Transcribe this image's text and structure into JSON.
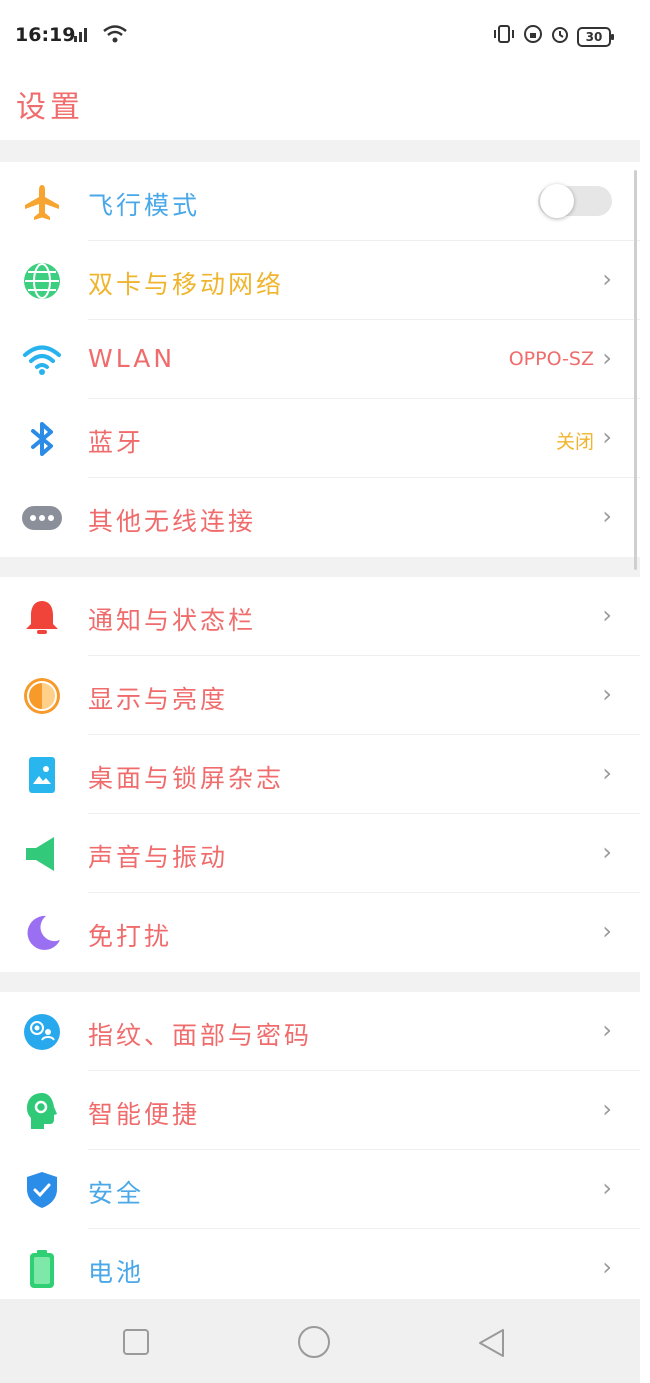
{
  "status_bar": {
    "time": "16:19",
    "battery": "30"
  },
  "header": {
    "title": "设置"
  },
  "groups": [
    {
      "items": [
        {
          "label": "飞行模式",
          "icon": "airplane-icon",
          "color": "#f7a530",
          "label_color": "#4aa8e8",
          "toggle": false
        },
        {
          "label": "双卡与移动网络",
          "icon": "globe-icon",
          "color": "#3ccf7f",
          "label_color": "#f0b52e"
        },
        {
          "label": "WLAN",
          "value": "OPPO-SZ",
          "icon": "wifi-icon",
          "color": "#29b3ee",
          "label_color": "#f06c6c",
          "value_color": "#f06c6c"
        },
        {
          "label": "蓝牙",
          "value": "关闭",
          "icon": "bluetooth-icon",
          "color": "#2b8ce8",
          "label_color": "#f06c6c",
          "value_color": "#f0b52e"
        },
        {
          "label": "其他无线连接",
          "icon": "more-icon",
          "color": "#8a8f99",
          "label_color": "#f06c6c"
        }
      ]
    },
    {
      "items": [
        {
          "label": "通知与状态栏",
          "icon": "bell-icon",
          "color": "#f0443a",
          "label_color": "#f06c6c"
        },
        {
          "label": "显示与亮度",
          "icon": "brightness-icon",
          "color": "#f79a2a",
          "label_color": "#f06c6c"
        },
        {
          "label": "桌面与锁屏杂志",
          "icon": "wallpaper-icon",
          "color": "#29b6ef",
          "label_color": "#f06c6c"
        },
        {
          "label": "声音与振动",
          "icon": "speaker-icon",
          "color": "#33c97a",
          "label_color": "#f06c6c"
        },
        {
          "label": "免打扰",
          "icon": "moon-icon",
          "color": "#9b6ff2",
          "label_color": "#f06c6c"
        }
      ]
    },
    {
      "items": [
        {
          "label": "指纹、面部与密码",
          "icon": "fingerprint-face-icon",
          "color": "#28a9ee",
          "label_color": "#f06c6c"
        },
        {
          "label": "智能便捷",
          "icon": "smart-assist-icon",
          "color": "#2fc978",
          "label_color": "#f06c6c"
        },
        {
          "label": "安全",
          "icon": "shield-icon",
          "color": "#2b8de8",
          "label_color": "#4aa8e8"
        },
        {
          "label": "电池",
          "icon": "battery-icon",
          "color": "#2fcf73",
          "label_color": "#4aa8e8"
        }
      ]
    }
  ],
  "nav_bar": {
    "items": [
      "recent-apps-button",
      "home-button",
      "back-button"
    ]
  }
}
